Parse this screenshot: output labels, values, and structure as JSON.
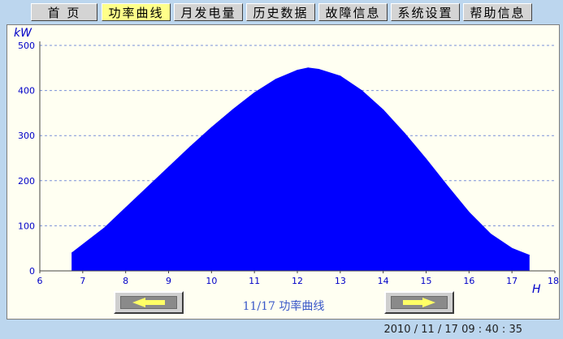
{
  "tabs": [
    {
      "label": "首  页",
      "active": false
    },
    {
      "label": "功率曲线",
      "active": true
    },
    {
      "label": "月发电量",
      "active": false
    },
    {
      "label": "历史数据",
      "active": false
    },
    {
      "label": "故障信息",
      "active": false
    },
    {
      "label": "系统设置",
      "active": false
    },
    {
      "label": "帮助信息",
      "active": false
    }
  ],
  "chart": {
    "caption": "11/17 功率曲线",
    "prev_icon": "left-arrow-icon",
    "next_icon": "right-arrow-icon"
  },
  "chart_data": {
    "type": "area",
    "ylabel": "kW",
    "xlabel": "H",
    "xlim": [
      6,
      18
    ],
    "ylim": [
      0,
      500
    ],
    "xticks": [
      "6",
      "7",
      "8",
      "9",
      "10",
      "11",
      "12",
      "13",
      "14",
      "15",
      "16",
      "17",
      "18"
    ],
    "yticks": [
      "0",
      "100",
      "200",
      "300",
      "400",
      "500"
    ],
    "grid": true,
    "color": "#0000ff",
    "x": [
      6.75,
      7.5,
      8.0,
      8.5,
      9.0,
      9.5,
      10.0,
      10.5,
      11.0,
      11.5,
      12.0,
      12.25,
      12.5,
      13.0,
      13.5,
      14.0,
      14.5,
      15.0,
      15.5,
      16.0,
      16.5,
      17.0,
      17.4
    ],
    "y": [
      40,
      95,
      140,
      185,
      230,
      275,
      318,
      358,
      395,
      425,
      445,
      450,
      447,
      432,
      400,
      357,
      305,
      248,
      188,
      130,
      82,
      50,
      35
    ]
  },
  "status": {
    "datetime": "2010 / 11 / 17    09 : 40 : 35"
  }
}
